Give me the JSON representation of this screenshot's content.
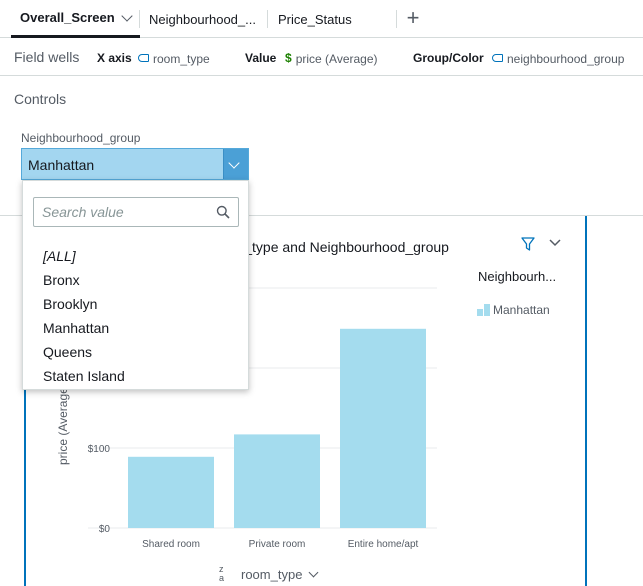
{
  "tabs": [
    {
      "label": "Overall_Screen",
      "active": true
    },
    {
      "label": "Neighbourhood_...",
      "active": false
    },
    {
      "label": "Price_Status",
      "active": false
    }
  ],
  "field_wells": {
    "title": "Field wells",
    "x_axis": {
      "label": "X axis",
      "value": "room_type",
      "icon": "dimension-tag-icon"
    },
    "value": {
      "label": "Value",
      "value": "price (Average)",
      "icon": "dollar-icon"
    },
    "group": {
      "label": "Group/Color",
      "value": "neighbourhood_group",
      "icon": "dimension-tag-icon"
    }
  },
  "controls": {
    "title": "Controls",
    "control_label": "Neighbourhood_group",
    "selected": "Manhattan",
    "dropdown": {
      "search_placeholder": "Search value",
      "options": [
        "[ALL]",
        "Bronx",
        "Brooklyn",
        "Manhattan",
        "Queens",
        "Staten Island"
      ]
    }
  },
  "visual": {
    "title": "oom_type and Neighbourhood_group",
    "legend_title": "Neighbourh...",
    "legend_items": [
      "Manhattan"
    ],
    "x_field": "room_type",
    "colors": {
      "bar": "#a4dcee",
      "accent": "#0073bb"
    }
  },
  "chart_data": {
    "type": "bar",
    "categories": [
      "Shared room",
      "Private room",
      "Entire home/apt"
    ],
    "series": [
      {
        "name": "Manhattan",
        "values": [
          89,
          117,
          249
        ]
      }
    ],
    "ylabel": "price (Average",
    "xlabel": "room_type",
    "yticks": [
      "$0",
      "$100"
    ],
    "ylim": [
      0,
      300
    ],
    "grid": true,
    "legend": "top-right"
  }
}
